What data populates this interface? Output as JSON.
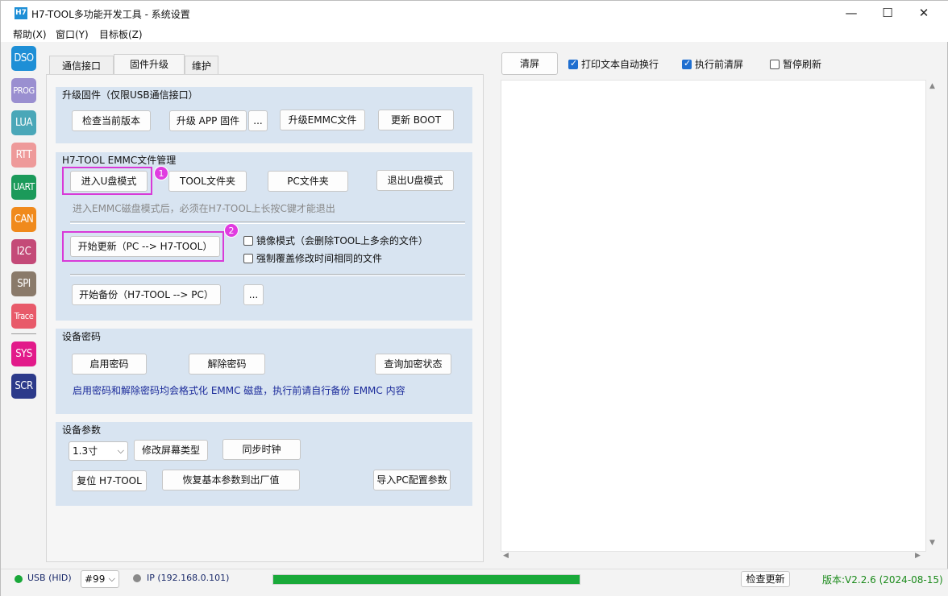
{
  "window": {
    "icon_text": "H7",
    "title": "H7-TOOL多功能开发工具 - 系统设置",
    "minimize": "—",
    "maximize": "☐",
    "close": "✕"
  },
  "menu": [
    "帮助(X)",
    "窗口(Y)",
    "目标板(Z)"
  ],
  "tools": [
    {
      "label": "DSO",
      "color": "#1e8fd6"
    },
    {
      "label": "PROG",
      "color": "#9a8fd0"
    },
    {
      "label": "LUA",
      "color": "#4aa7b8"
    },
    {
      "label": "RTT",
      "color": "#ee9a9a"
    },
    {
      "label": "UART",
      "color": "#1b9a5a"
    },
    {
      "label": "CAN",
      "color": "#f08a1c"
    },
    {
      "label": "I2C",
      "color": "#c44a78"
    },
    {
      "label": "SPI",
      "color": "#8a7a6a"
    },
    {
      "label": "Trace",
      "color": "#e85a6a"
    },
    {
      "label": "SYS",
      "color": "#e21a8a"
    },
    {
      "label": "SCR",
      "color": "#2c3a8a"
    }
  ],
  "tabs": [
    "通信接口",
    "固件升级",
    "维护"
  ],
  "upgrade": {
    "title": "升级固件（仅限USB通信接口）",
    "check_version": "检查当前版本",
    "upgrade_app": "升级 APP 固件",
    "ellipsis": "...",
    "upgrade_emmc": "升级EMMC文件",
    "update_boot": "更新 BOOT"
  },
  "emmc": {
    "title": "H7-TOOL EMMC文件管理",
    "enter_udisk": "进入U盘模式",
    "tool_folder": "TOOL文件夹",
    "pc_folder": "PC文件夹",
    "exit_udisk": "退出U盘模式",
    "hint": "进入EMMC磁盘模式后，必须在H7-TOOL上长按C键才能退出",
    "start_update": "开始更新（PC --> H7-TOOL）",
    "mirror_mode": "镜像模式（会删除TOOL上多余的文件）",
    "force_overwrite": "强制覆盖修改时间相同的文件",
    "start_backup": "开始备份（H7-TOOL --> PC）",
    "ellipsis": "...",
    "badge1": "1",
    "badge2": "2"
  },
  "password": {
    "title": "设备密码",
    "enable": "启用密码",
    "disable": "解除密码",
    "query": "查询加密状态",
    "note": "启用密码和解除密码均会格式化 EMMC 磁盘，执行前请自行备份 EMMC 内容"
  },
  "params": {
    "title": "设备参数",
    "screen_size": "1.3寸",
    "modify_screen": "修改屏幕类型",
    "sync_clock": "同步时钟",
    "reset": "复位 H7-TOOL",
    "restore": "恢复基本参数到出厂值",
    "import": "导入PC配置参数"
  },
  "right": {
    "clear": "清屏",
    "auto_wrap": "打印文本自动换行",
    "auto_wrap_checked": true,
    "clear_before": "执行前清屏",
    "clear_before_checked": true,
    "pause_refresh": "暂停刷新",
    "pause_refresh_checked": false
  },
  "status": {
    "usb": "USB (HID)",
    "usb_color": "#1aa83a",
    "device": "#99",
    "ip": "IP (192.168.0.101)",
    "ip_color": "#8a8a8a",
    "progress": 1.0,
    "progress_color": "#1aaa3a",
    "check_update": "检查更新",
    "version": "版本:V2.2.6 (2024-08-15)",
    "version_color": "#1a8a1a"
  }
}
